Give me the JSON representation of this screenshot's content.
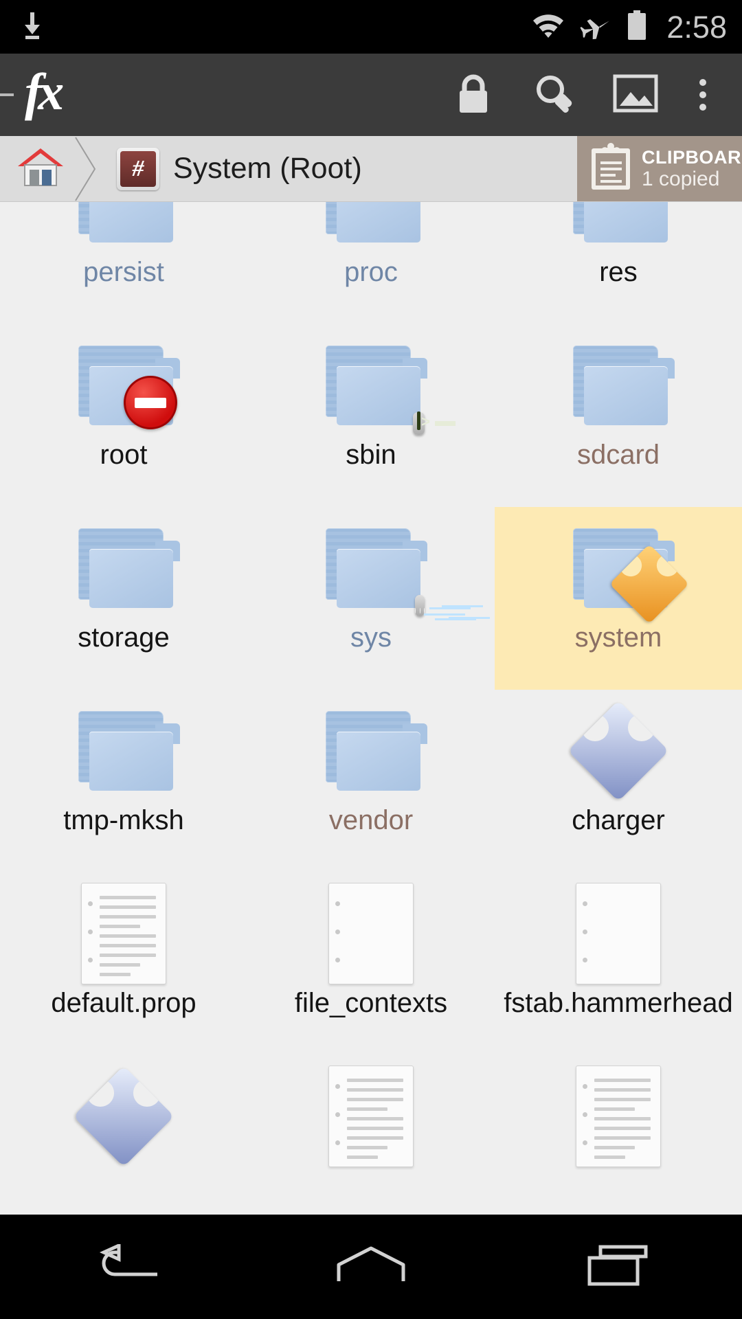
{
  "statusbar": {
    "time": "2:58",
    "icons": [
      "download-icon",
      "wifi-icon",
      "airplane-mode-icon",
      "battery-icon"
    ]
  },
  "appbar": {
    "logo": "fx",
    "drawer": "drawer-handle",
    "actions": [
      {
        "name": "lock-icon",
        "label": "Lock"
      },
      {
        "name": "search-icon",
        "label": "Search"
      },
      {
        "name": "image-icon",
        "label": "Images"
      },
      {
        "name": "overflow-menu-icon",
        "label": "More options"
      }
    ]
  },
  "breadcrumb": {
    "home": "home-icon",
    "separator": "chevron-right-icon",
    "badge": "#",
    "title": "System (Root)",
    "clipboard": {
      "icon": "clipboard-icon",
      "title": "CLIPBOARD",
      "subtitle": "1 copied"
    }
  },
  "grid": {
    "items": [
      {
        "label": "persist",
        "type": "folder",
        "style": "link",
        "badge": "none",
        "selected": false
      },
      {
        "label": "proc",
        "type": "folder",
        "style": "link",
        "badge": "none",
        "selected": false
      },
      {
        "label": "res",
        "type": "folder",
        "style": "plain",
        "badge": "none",
        "selected": false
      },
      {
        "label": "root",
        "type": "folder",
        "style": "plain",
        "badge": "stop",
        "selected": false
      },
      {
        "label": "sbin",
        "type": "folder",
        "style": "plain",
        "badge": "terminal",
        "selected": false
      },
      {
        "label": "sdcard",
        "type": "folder",
        "style": "mount",
        "badge": "none",
        "selected": false
      },
      {
        "label": "storage",
        "type": "folder",
        "style": "plain",
        "badge": "none",
        "selected": false
      },
      {
        "label": "sys",
        "type": "folder",
        "style": "link",
        "badge": "monitor",
        "selected": false
      },
      {
        "label": "system",
        "type": "folder",
        "style": "mount",
        "badge": "package",
        "selected": true
      },
      {
        "label": "tmp-mksh",
        "type": "folder",
        "style": "plain",
        "badge": "none",
        "selected": false
      },
      {
        "label": "vendor",
        "type": "folder",
        "style": "mount",
        "badge": "none",
        "selected": false
      },
      {
        "label": "charger",
        "type": "package",
        "style": "plain",
        "badge": "none",
        "selected": false
      },
      {
        "label": "default.prop",
        "type": "doc",
        "style": "plain",
        "badge": "none",
        "selected": false,
        "lines": 9
      },
      {
        "label": "file_contexts",
        "type": "doc",
        "style": "plain",
        "badge": "none",
        "selected": false,
        "lines": 0
      },
      {
        "label": "fstab.hammerhead",
        "type": "doc",
        "style": "plain",
        "badge": "none",
        "selected": false,
        "lines": 0
      },
      {
        "label": "",
        "type": "package",
        "style": "plain",
        "badge": "none",
        "selected": false
      },
      {
        "label": "",
        "type": "doc",
        "style": "plain",
        "badge": "none",
        "selected": false,
        "lines": 9
      },
      {
        "label": "",
        "type": "doc",
        "style": "plain",
        "badge": "none",
        "selected": false,
        "lines": 9
      }
    ]
  },
  "navbar": {
    "buttons": [
      {
        "name": "nav-back-button",
        "label": "Back"
      },
      {
        "name": "nav-home-button",
        "label": "Home"
      },
      {
        "name": "nav-recents-button",
        "label": "Recents"
      }
    ]
  },
  "colors": {
    "statusbar_bg": "#000000",
    "appbar_bg": "#3b3b3b",
    "breadcrumb_bg": "#dcdcdc",
    "clipboard_bg": "#a3958a",
    "grid_bg": "#efefef",
    "selection_bg": "#fdeab4",
    "link_text": "#6f86a6",
    "mount_text": "#8b6f64",
    "badge_red": "#8d4440"
  }
}
